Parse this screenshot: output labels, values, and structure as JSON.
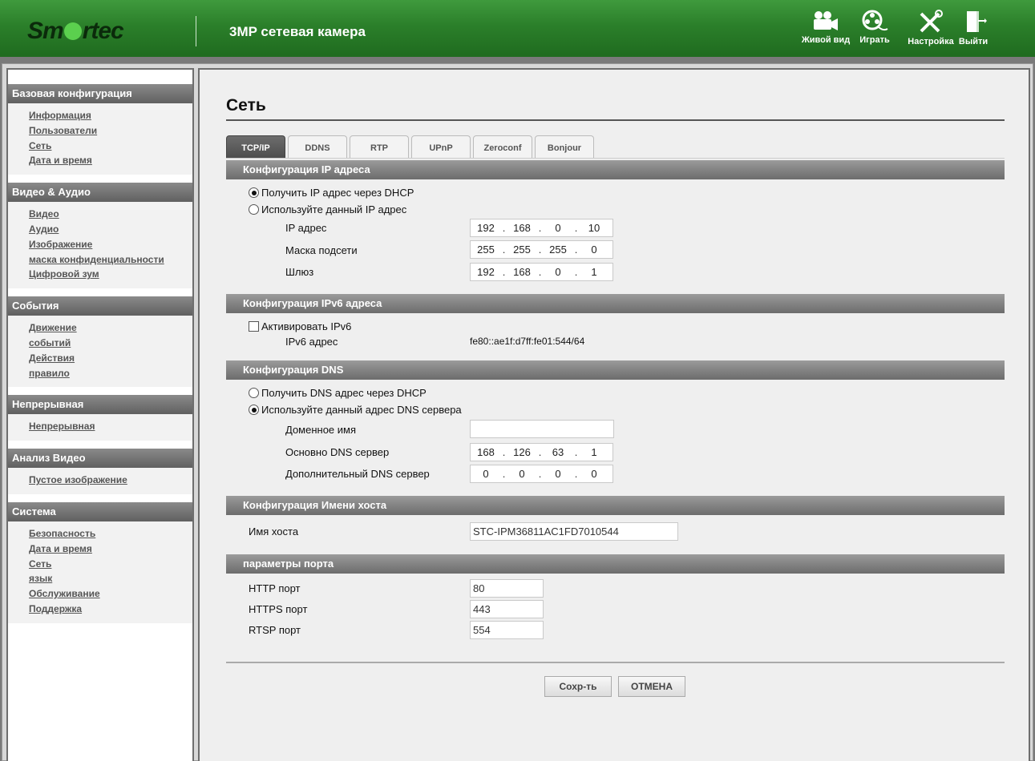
{
  "header": {
    "logo_text": "Smartec",
    "title": "3MP сетевая камера",
    "nav": [
      {
        "label": "Живой вид",
        "icon": "video-camera-icon"
      },
      {
        "label": "Играть",
        "icon": "film-reel-icon"
      },
      {
        "label": "Настройка",
        "icon": "tools-icon"
      },
      {
        "label": "Выйти",
        "icon": "exit-door-icon"
      }
    ]
  },
  "sidebar": {
    "sections": [
      {
        "title": "Базовая конфигурация",
        "links": [
          "Информация",
          "Пользователи",
          "Сеть",
          "Дата и время"
        ]
      },
      {
        "title": "Видео & Аудио",
        "links": [
          "Видео",
          "Аудио",
          "Изображение",
          "маска конфиденциальности",
          "Цифровой зум"
        ]
      },
      {
        "title": "События",
        "links": [
          "Движение",
          "событий",
          "Действия",
          "правило"
        ]
      },
      {
        "title": "Непрерывная",
        "links": [
          "Непрерывная"
        ]
      },
      {
        "title": "Анализ Видео",
        "links": [
          "Пустое изображение"
        ]
      },
      {
        "title": "Система",
        "links": [
          "Безопасность",
          "Дата и время",
          "Сеть",
          "язык",
          "Обслуживание",
          "Поддержка"
        ]
      }
    ]
  },
  "main": {
    "title": "Сеть",
    "tabs": [
      "TCP/IP",
      "DDNS",
      "RTP",
      "UPnP",
      "Zeroconf",
      "Bonjour"
    ],
    "active_tab": "TCP/IP",
    "ip": {
      "section": "Конфигурация IP адреса",
      "dhcp_label": "Получить IP адрес через DHCP",
      "static_label": "Используйте данный IP адрес",
      "ip_label": "IP адрес",
      "ip_value": [
        "192",
        "168",
        "0",
        "10"
      ],
      "mask_label": "Маска подсети",
      "mask_value": [
        "255",
        "255",
        "255",
        "0"
      ],
      "gw_label": "Шлюз",
      "gw_value": [
        "192",
        "168",
        "0",
        "1"
      ]
    },
    "ipv6": {
      "section": "Конфигурация IPv6 адреса",
      "enable_label": "Активировать IPv6",
      "addr_label": "IPv6 адрес",
      "addr_value": "fe80::ae1f:d7ff:fe01:544/64"
    },
    "dns": {
      "section": "Конфигурация DNS",
      "dhcp_label": "Получить DNS адрес через DHCP",
      "static_label": "Используйте данный адрес DNS сервера",
      "domain_label": "Доменное имя",
      "domain_value": "",
      "primary_label": "Основно DNS сервер",
      "primary_value": [
        "168",
        "126",
        "63",
        "1"
      ],
      "secondary_label": "Дополнительный DNS сервер",
      "secondary_value": [
        "0",
        "0",
        "0",
        "0"
      ]
    },
    "host": {
      "section": "Конфигурация Имени хоста",
      "label": "Имя хоста",
      "value": "STC-IPM36811AC1FD7010544"
    },
    "ports": {
      "section": "параметры порта",
      "http_label": "HTTP порт",
      "http_value": "80",
      "https_label": "HTTPS порт",
      "https_value": "443",
      "rtsp_label": "RTSP порт",
      "rtsp_value": "554"
    },
    "buttons": {
      "save": "Сохр-ть",
      "cancel": "ОТМЕНА"
    }
  }
}
